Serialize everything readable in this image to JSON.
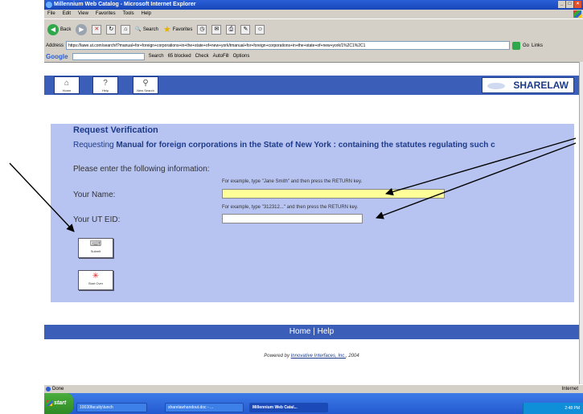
{
  "window": {
    "title": "Millennium Web Catalog - Microsoft Internet Explorer"
  },
  "menubar": {
    "items": [
      "File",
      "Edit",
      "View",
      "Favorites",
      "Tools",
      "Help"
    ]
  },
  "toolbar": {
    "back": "Back",
    "search": "Search",
    "favorites": "Favorites"
  },
  "address": {
    "label": "Address",
    "url": "https://lawe.ut.com/search/t?manual+for+foreign+corporations+in+the+state+of+new+york/tmanual+for+foreign+corporations+in+the+state+of+new+york/1%2C1%2C1",
    "go": "Go",
    "links": "Links"
  },
  "googlebar": {
    "logo": "Google",
    "search": "Search",
    "blocked": "65 blocked",
    "check": "Check",
    "autofill": "AutoFill",
    "options": "Options"
  },
  "navbuttons": {
    "home": "Home",
    "help": "Help",
    "new_search": "New Search"
  },
  "logo": {
    "text": "SHARELAW"
  },
  "form": {
    "title": "Request Verification",
    "requesting_prefix": "Requesting",
    "requesting_title": "Manual for foreign corporations in the State of New York : containing the statutes regulating such c",
    "instructions": "Please enter the following information:",
    "name_hint": "For example, type \"Jane Smith\" and then press the RETURN key.",
    "name_label": "Your Name:",
    "name_value": "",
    "eid_hint": "For example, type \"312312...\" and then press the RETURN key.",
    "eid_label": "Your UT EID:",
    "eid_value": "",
    "submit": "Submit",
    "start_over": "Start Over"
  },
  "footer": {
    "home": "Home",
    "sep": "|",
    "help": "Help",
    "powered_prefix": "Powered by",
    "powered_link": "Innovative Interfaces, Inc.",
    "powered_year": "2004"
  },
  "status": {
    "text": "Done",
    "zone": "Internet"
  },
  "taskbar": {
    "start": "start",
    "tasks": [
      "10030faculty\\lunch",
      "sharelawhandout.doc - ...",
      "Millennium Web Catal..."
    ],
    "clock": "2:48 PM"
  },
  "colors": {
    "accent": "#3b5fb8",
    "panel": "#b7c3f0",
    "name_field": "#ffff99",
    "heading": "#1d3b8a"
  }
}
